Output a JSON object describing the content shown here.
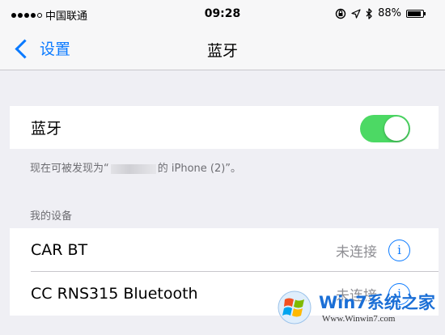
{
  "status_bar": {
    "carrier": "中国联通",
    "time": "09:28",
    "battery_percent": "88%",
    "battery_level": 0.88,
    "icons": [
      "signal-dots-icon",
      "orientation-lock-icon",
      "location-icon",
      "bluetooth-icon",
      "battery-icon"
    ]
  },
  "nav": {
    "back_label": "设置",
    "title": "蓝牙"
  },
  "bluetooth": {
    "label": "蓝牙",
    "enabled": true,
    "toggle_color": "#4cd964"
  },
  "discover_note": {
    "prefix": "现在可被发现为“",
    "suffix": "的 iPhone (2)”。"
  },
  "devices_section": {
    "header": "我的设备",
    "devices": [
      {
        "name": "CAR BT",
        "status": "未连接"
      },
      {
        "name": "CC RNS315 Bluetooth",
        "status": "未连接"
      }
    ]
  },
  "watermark": {
    "title": "Win7系统之家",
    "url": "Www.Winwin7.com"
  },
  "colors": {
    "accent": "#0a7aff",
    "background": "#efeff4"
  }
}
